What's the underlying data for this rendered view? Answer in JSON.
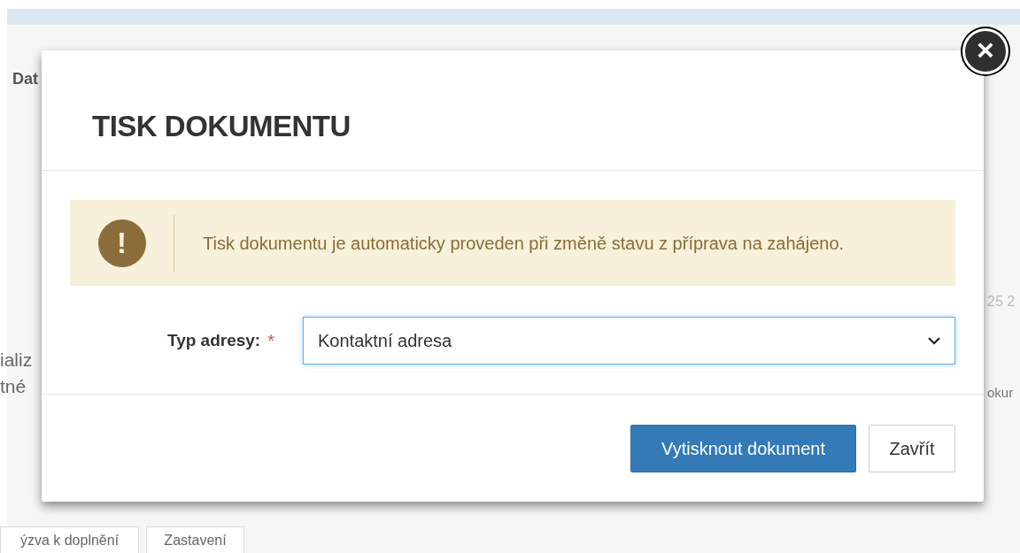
{
  "background": {
    "texts": [
      "Dat",
      "ializ",
      "tné",
      "25 2",
      "okur"
    ],
    "buttons": [
      "ýzva k doplnění",
      "Zastavení"
    ]
  },
  "modal": {
    "title": "TISK DOKUMENTU",
    "close_icon": "×",
    "alert": {
      "icon": "!",
      "text": "Tisk dokumentu je automaticky proveden při změně stavu z příprava na zahájeno."
    },
    "field": {
      "label": "Typ adresy:",
      "required_mark": "*",
      "value": "Kontaktní adresa",
      "focused": true
    },
    "buttons": [
      {
        "label": "Vytisknout dokument",
        "kind": "primary"
      },
      {
        "label": "Zavřít",
        "kind": "default"
      }
    ]
  }
}
